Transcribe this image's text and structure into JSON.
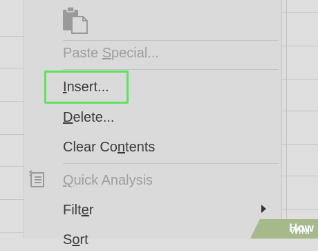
{
  "menu": {
    "items": [
      {
        "pre": "Paste ",
        "u": "S",
        "post": "pecial...",
        "state": "disabled"
      },
      {
        "pre": "",
        "u": "I",
        "post": "nsert...",
        "state": "highlighted"
      },
      {
        "pre": "",
        "u": "D",
        "post": "elete...",
        "state": "normal"
      },
      {
        "pre": "Clear Co",
        "u": "n",
        "post": "tents",
        "state": "normal"
      },
      {
        "pre": "",
        "u": "Q",
        "post": "uick Analysis",
        "state": "disabled"
      },
      {
        "pre": "Filt",
        "u": "e",
        "post": "r",
        "state": "normal",
        "submenu": true
      },
      {
        "pre": "S",
        "u": "o",
        "post": "rt",
        "state": "normal"
      }
    ],
    "icons": [
      "paste-icon",
      "quick-analysis-icon",
      "submenu-arrow-icon"
    ]
  },
  "watermark": {
    "prefix": "wiki",
    "bold": "How"
  },
  "colors": {
    "highlight": "#5ee35b",
    "menu_bg": "#dadada",
    "disabled_text": "#9e9e9e",
    "text": "#3a3a3a",
    "watermark_bg": "#a5b98b"
  }
}
